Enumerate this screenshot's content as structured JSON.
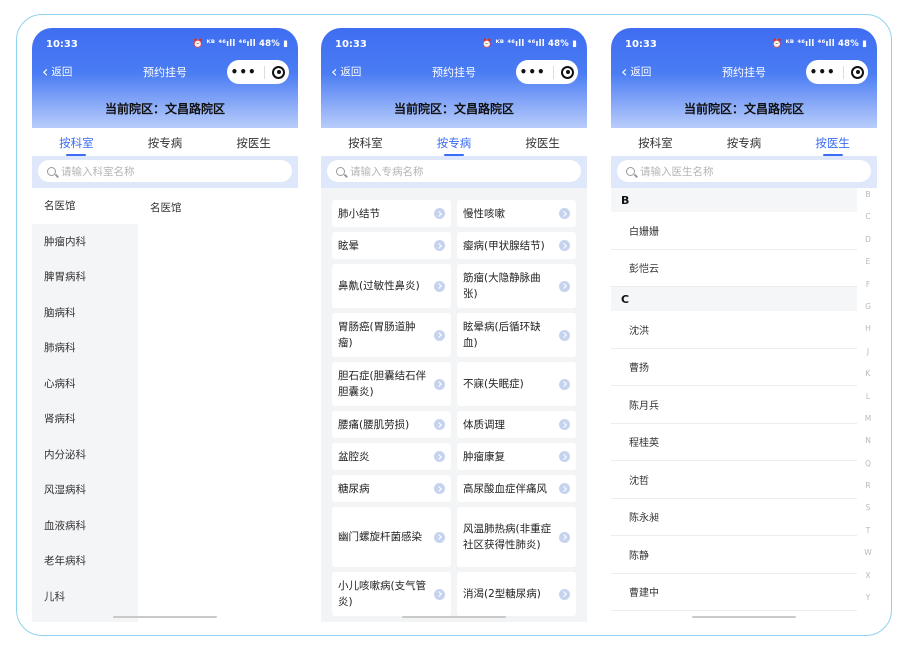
{
  "status": {
    "time": "10:33",
    "indicators": "⏰ ᴷᴮ ⁴⁶ıll ⁴⁶ıll 48% ▮"
  },
  "nav": {
    "back_label": "返回",
    "title": "预约挂号"
  },
  "campus": "当前院区：文昌路院区",
  "tabs": [
    "按科室",
    "按专病",
    "按医生"
  ],
  "screen_dept": {
    "search_placeholder": "请输入科室名称",
    "departments": [
      "名医馆",
      "肿瘤内科",
      "脾胃病科",
      "脑病科",
      "肺病科",
      "心病科",
      "肾病科",
      "内分泌科",
      "风湿病科",
      "血液病科",
      "老年病科",
      "儿科"
    ],
    "sub_departments": [
      "名医馆"
    ]
  },
  "screen_disease": {
    "search_placeholder": "请输入专病名称",
    "diseases": [
      "肺小结节",
      "慢性咳嗽",
      "眩晕",
      "瘿病(甲状腺结节)",
      "鼻鼽(过敏性鼻炎)",
      "筋瘤(大隐静脉曲张)",
      "胃肠癌(胃肠道肿瘤)",
      "眩晕病(后循环缺血)",
      "胆石症(胆囊结石伴胆囊炎)",
      "不寐(失眠症)",
      "腰痛(腰肌劳损)",
      "体质调理",
      "盆腔炎",
      "肿瘤康复",
      "糖尿病",
      "高尿酸血症伴痛风",
      "幽门螺旋杆菌感染",
      "风温肺热病(非重症社区获得性肺炎)",
      "小儿咳嗽病(支气管炎)",
      "消渴(2型糖尿病)"
    ]
  },
  "screen_doctor": {
    "search_placeholder": "请输入医生名称",
    "groups": [
      {
        "letter": "B",
        "doctors": [
          "白姗姗",
          "彭恺云"
        ]
      },
      {
        "letter": "C",
        "doctors": [
          "沈洪",
          "曹扬",
          "陈月兵",
          "程桂英",
          "沈哲",
          "陈永昶",
          "陈静",
          "曹建中"
        ]
      }
    ],
    "index_letters": [
      "B",
      "C",
      "D",
      "E",
      "F",
      "G",
      "H",
      "J",
      "K",
      "L",
      "M",
      "N",
      "Q",
      "R",
      "S",
      "T",
      "W",
      "X",
      "Y"
    ]
  },
  "colors": {
    "primary": "#3a6cf4",
    "header_gradient_top": "#3f6df1",
    "search_band": "#dfe8fb"
  }
}
